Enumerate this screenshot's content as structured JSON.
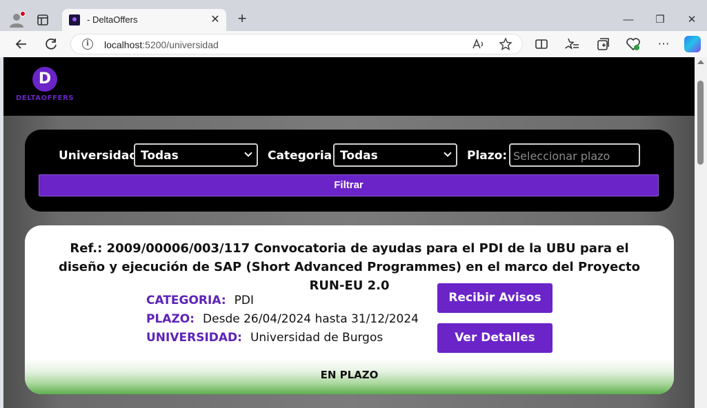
{
  "browser": {
    "tab_title": "- DeltaOffers",
    "url_host": "localhost",
    "url_path": ":5200/universidad"
  },
  "site": {
    "logo_letter": "D",
    "logo_text": "DELTAOFFERS"
  },
  "filters": {
    "universidad_label": "Universidad:",
    "universidad_value": "Todas",
    "categoria_label": "Categoria:",
    "categoria_value": "Todas",
    "plazo_label": "Plazo:",
    "plazo_placeholder": "Seleccionar plazo",
    "filter_button": "Filtrar"
  },
  "offer": {
    "title": "Ref.: 2009/00006/003/117 Convocatoria de ayudas para el PDI de la UBU para el diseño y ejecución de SAP (Short Advanced Programmes) en el marco del Proyecto RUN-EU 2.0",
    "categoria_key": "CATEGORIA:",
    "categoria_val": "PDI",
    "plazo_key": "PLAZO:",
    "plazo_val": "Desde 26/04/2024 hasta 31/12/2024",
    "universidad_key": "UNIVERSIDAD:",
    "universidad_val": "Universidad de Burgos",
    "avisos_button": "Recibir Avisos",
    "detalles_button": "Ver Detalles",
    "status": "EN PLAZO",
    "status_color": "#5fae4f"
  },
  "colors": {
    "accent": "#6a24c8",
    "header_bg": "#000000"
  }
}
